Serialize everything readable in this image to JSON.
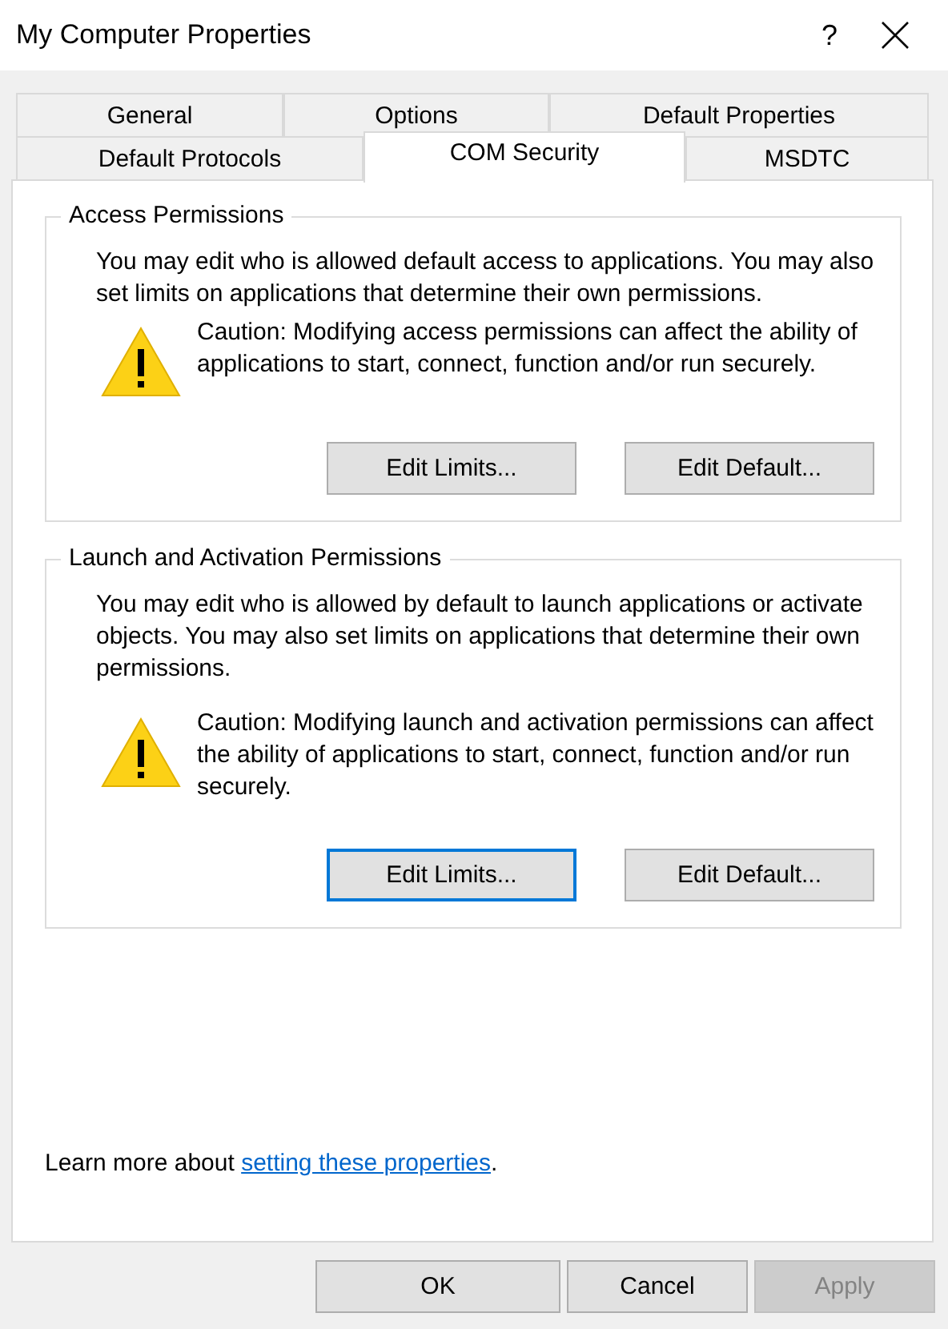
{
  "window": {
    "title": "My Computer Properties",
    "help": "?"
  },
  "tab_rows": [
    [
      {
        "label": "General",
        "selected": false
      },
      {
        "label": "Options",
        "selected": false
      },
      {
        "label": "Default Properties",
        "selected": false
      }
    ],
    [
      {
        "label": "Default Protocols",
        "selected": false
      },
      {
        "label": "COM Security",
        "selected": true
      },
      {
        "label": "MSDTC",
        "selected": false
      }
    ]
  ],
  "groups": [
    {
      "title": "Access Permissions",
      "description": "You may edit who is allowed default access to applications. You may also set limits on applications that determine their own permissions.",
      "caution": "Caution: Modifying access permissions can affect the ability of applications to start, connect, function and/or run securely.",
      "buttons": [
        {
          "label": "Edit Limits...",
          "focused": false
        },
        {
          "label": "Edit Default...",
          "focused": false
        }
      ]
    },
    {
      "title": "Launch and Activation Permissions",
      "description": "You may edit who is allowed by default to launch applications or activate objects. You may also set limits on applications that determine their own permissions.",
      "caution": "Caution: Modifying launch and activation permissions can affect the ability of applications to start, connect, function and/or run securely.",
      "buttons": [
        {
          "label": "Edit Limits...",
          "focused": true
        },
        {
          "label": "Edit Default...",
          "focused": false
        }
      ]
    }
  ],
  "learn_more": {
    "before": "Learn more about ",
    "link": "setting these properties",
    "after": "."
  },
  "buttons": [
    {
      "label": "OK",
      "disabled": false
    },
    {
      "label": "Cancel",
      "disabled": false
    },
    {
      "label": "Apply",
      "disabled": true
    }
  ]
}
